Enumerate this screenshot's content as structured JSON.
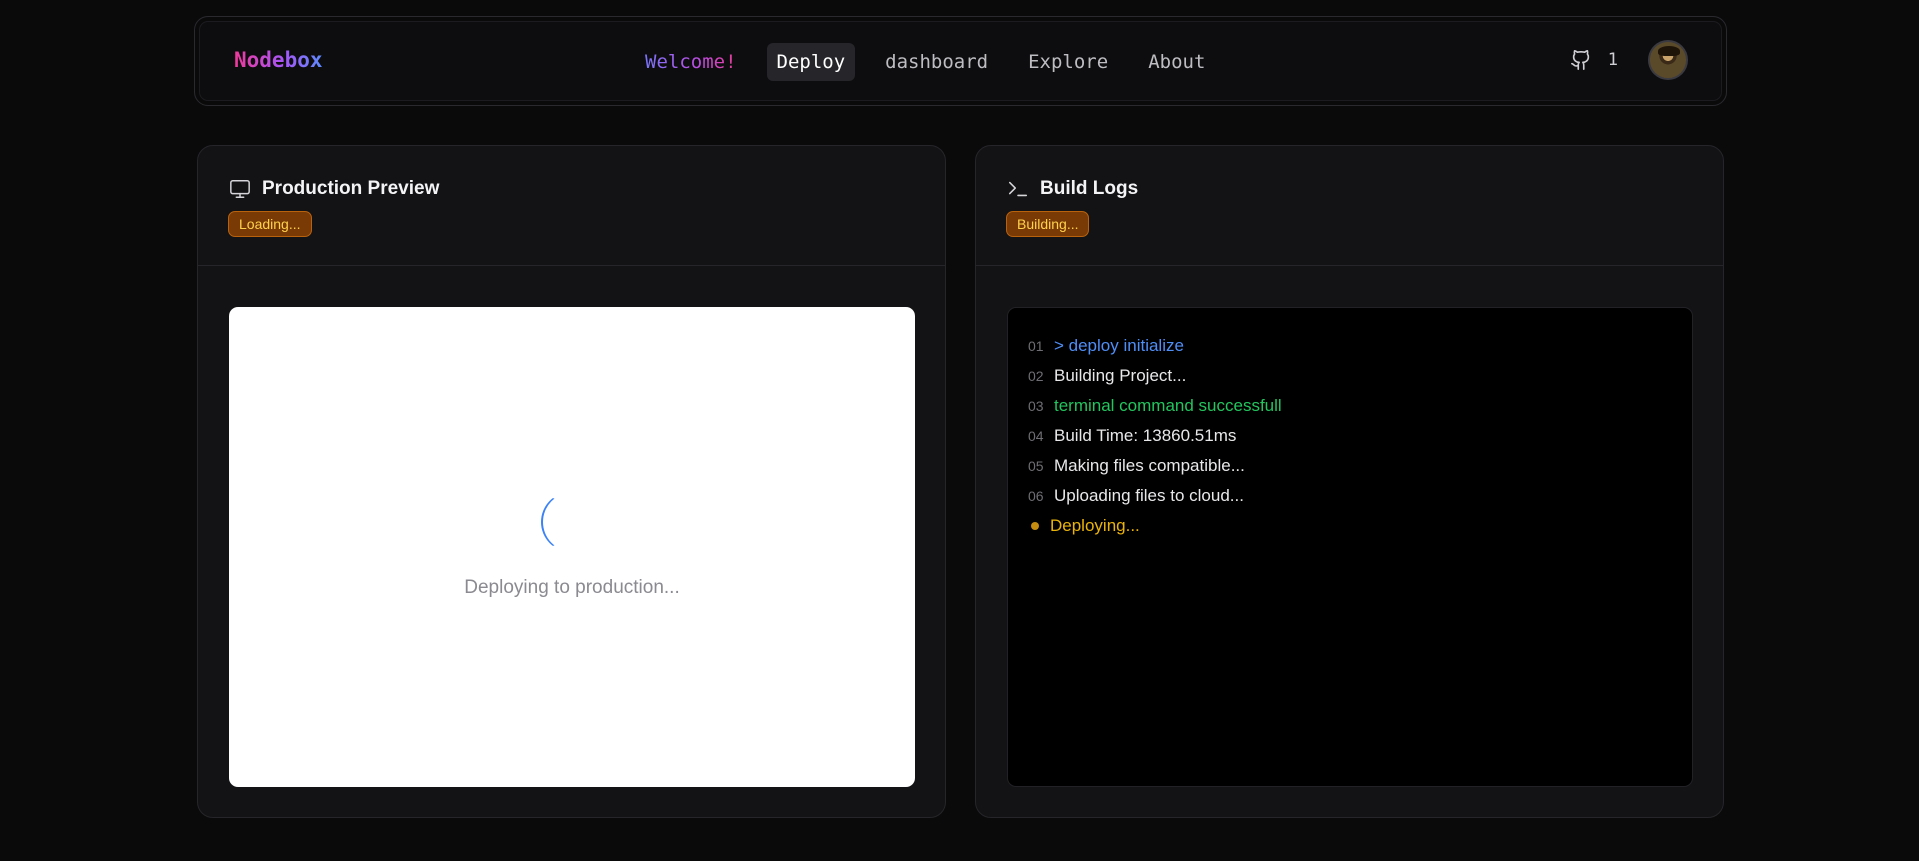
{
  "nav": {
    "brand": "Nodebox",
    "links": [
      {
        "label": "Welcome!"
      },
      {
        "label": "Deploy"
      },
      {
        "label": "dashboard"
      },
      {
        "label": "Explore"
      },
      {
        "label": "About"
      }
    ],
    "github_count": "1"
  },
  "preview": {
    "title": "Production Preview",
    "badge": "Loading...",
    "message": "Deploying to production..."
  },
  "logs": {
    "title": "Build Logs",
    "badge": "Building...",
    "lines": [
      {
        "num": "01",
        "text": "> deploy initialize"
      },
      {
        "num": "02",
        "text": "Building Project..."
      },
      {
        "num": "03",
        "text": "terminal command successfull"
      },
      {
        "num": "04",
        "text": "Build Time: 13860.51ms"
      },
      {
        "num": "05",
        "text": "Making files compatible..."
      },
      {
        "num": "06",
        "text": "Uploading files to cloud..."
      }
    ],
    "current": "Deploying..."
  },
  "colors": {
    "accent_blue": "#4f8ef7",
    "success_green": "#22c55e",
    "warning_yellow": "#eab308",
    "badge_bg": "#7a3a06"
  },
  "icons": {
    "github": "github-icon",
    "monitor": "monitor-icon",
    "terminal": "terminal-icon",
    "spinner": "loading-spinner-icon"
  }
}
